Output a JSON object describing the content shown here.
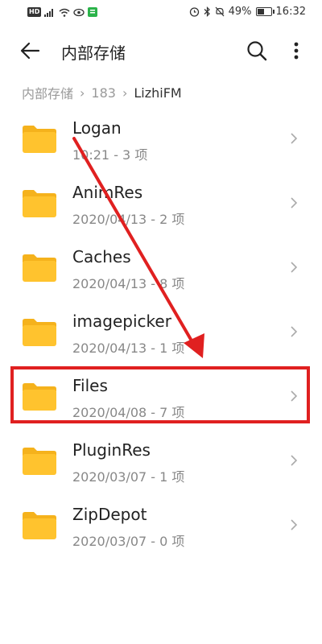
{
  "status_bar": {
    "badge": "HD",
    "battery": "49%",
    "battery_level": 0.49,
    "time": "16:32"
  },
  "app_bar": {
    "title": "内部存储"
  },
  "breadcrumb": {
    "items": [
      "内部存储",
      "183",
      "LizhiFM"
    ]
  },
  "folders": [
    {
      "name": "Logan",
      "meta": "10:21 - 3 项"
    },
    {
      "name": "AnimRes",
      "meta": "2020/04/13 - 2 项"
    },
    {
      "name": "Caches",
      "meta": "2020/04/13 - 8 项"
    },
    {
      "name": "imagepicker",
      "meta": "2020/04/13 - 1 项"
    },
    {
      "name": "Files",
      "meta": "2020/04/08 - 7 项"
    },
    {
      "name": "PluginRes",
      "meta": "2020/03/07 - 1 项"
    },
    {
      "name": "ZipDepot",
      "meta": "2020/03/07 - 0 项"
    }
  ],
  "colors": {
    "folder": "#FFC32E",
    "folder_back": "#F5B21C",
    "annotation": "#E02020"
  }
}
